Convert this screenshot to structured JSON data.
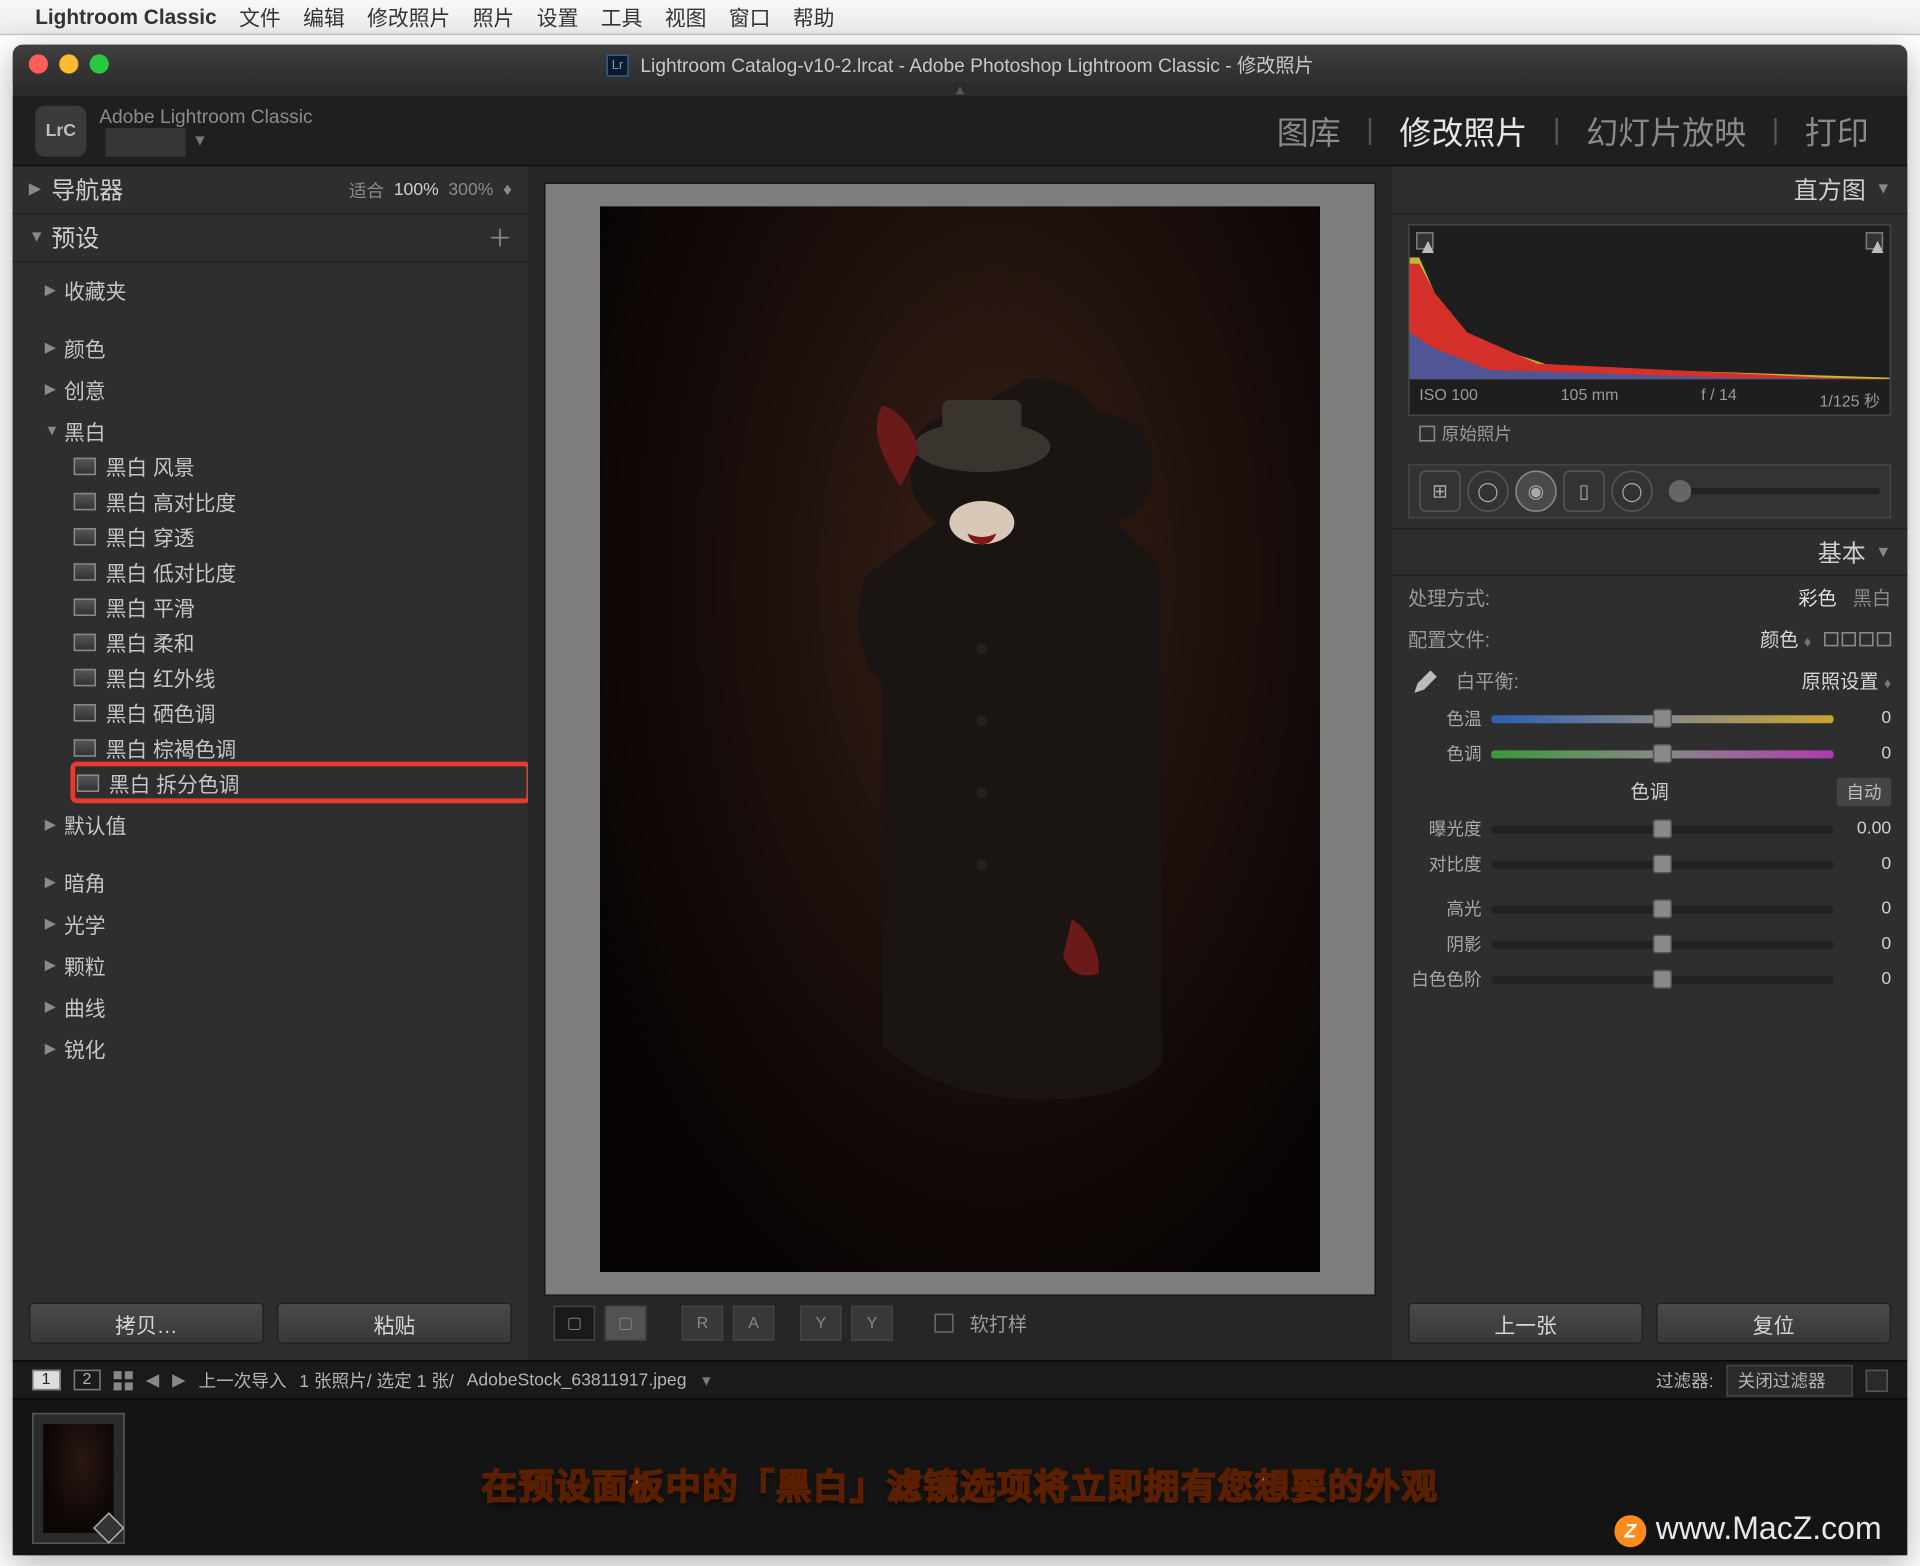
{
  "mac_menu": {
    "app_name": "Lightroom Classic",
    "items": [
      "文件",
      "编辑",
      "修改照片",
      "照片",
      "设置",
      "工具",
      "视图",
      "窗口",
      "帮助"
    ]
  },
  "window_title": "Lightroom Catalog-v10-2.lrcat - Adobe Photoshop Lightroom Classic - 修改照片",
  "identity_label": "Adobe Lightroom Classic",
  "modules": {
    "items": [
      "图库",
      "修改照片",
      "幻灯片放映",
      "打印"
    ],
    "active": "修改照片"
  },
  "left": {
    "navigator": {
      "label": "导航器",
      "fit": "适合",
      "z1": "100%",
      "z2": "300%"
    },
    "presets": {
      "label": "预设"
    },
    "groups": [
      {
        "label": "收藏夹",
        "open": false
      },
      {
        "label": "颜色",
        "open": false
      },
      {
        "label": "创意",
        "open": false
      },
      {
        "label": "黑白",
        "open": true,
        "items": [
          "黑白 风景",
          "黑白 高对比度",
          "黑白 穿透",
          "黑白 低对比度",
          "黑白 平滑",
          "黑白 柔和",
          "黑白 红外线",
          "黑白 硒色调",
          "黑白 棕褐色调",
          "黑白 拆分色调"
        ],
        "highlight": "黑白 拆分色调"
      },
      {
        "label": "默认值",
        "open": false
      },
      {
        "label": "暗角",
        "open": false
      },
      {
        "label": "光学",
        "open": false
      },
      {
        "label": "颗粒",
        "open": false
      },
      {
        "label": "曲线",
        "open": false
      },
      {
        "label": "锐化",
        "open": false
      }
    ],
    "copy_btn": "拷贝…",
    "paste_btn": "粘贴"
  },
  "center": {
    "softproof_label": "软打样",
    "proof_btns": [
      "R",
      "A",
      "Y",
      "Y"
    ]
  },
  "right": {
    "histogram_label": "直方图",
    "histogram_meta": {
      "iso": "ISO 100",
      "focal": "105 mm",
      "aperture": "f / 14",
      "shutter": "1/125 秒"
    },
    "original_label": "原始照片",
    "basic_label": "基本",
    "treatment": {
      "label": "处理方式:",
      "color": "彩色",
      "bw": "黑白"
    },
    "profile": {
      "label": "配置文件:",
      "value": "颜色"
    },
    "wb": {
      "label": "白平衡:",
      "value": "原照设置"
    },
    "sliders": {
      "temp": {
        "label": "色温",
        "value": "0",
        "pos": 50
      },
      "tint": {
        "label": "色调",
        "value": "0",
        "pos": 50
      },
      "tone_title": "色调",
      "auto": "自动",
      "exposure": {
        "label": "曝光度",
        "value": "0.00",
        "pos": 50
      },
      "contrast": {
        "label": "对比度",
        "value": "0",
        "pos": 50
      },
      "highlights": {
        "label": "高光",
        "value": "0",
        "pos": 50
      },
      "shadows": {
        "label": "阴影",
        "value": "0",
        "pos": 50
      },
      "whites": {
        "label": "白色色阶",
        "value": "0",
        "pos": 50
      }
    },
    "prev_btn": "上一张",
    "reset_btn": "复位"
  },
  "info_bar": {
    "pages": [
      "1",
      "2"
    ],
    "import_label": "上一次导入",
    "count_label": "1 张照片/ 选定 1 张/",
    "filename": "AdobeStock_63811917.jpeg",
    "filter_label": "过滤器:",
    "filter_value": "关闭过滤器"
  },
  "caption": "在预设面板中的「黑白」滤镜选项将立即拥有您想要的外观",
  "watermark": "www.MacZ.com"
}
